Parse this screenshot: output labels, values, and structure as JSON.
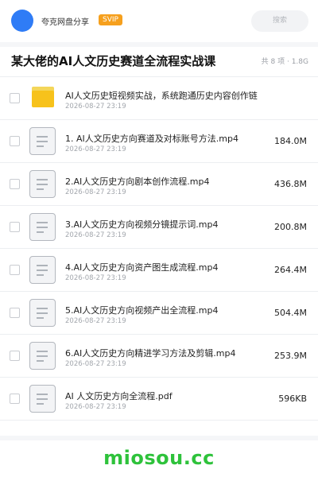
{
  "header": {
    "share_name": "夸克网盘分享",
    "badge": "SVIP",
    "search_label": "搜索"
  },
  "page": {
    "title": "某大佬的AI人文历史赛道全流程实战课",
    "meta": "共 8 项 · 1.8G"
  },
  "files": [
    {
      "type": "folder",
      "name": "AI人文历史短视频实战，系统跑通历史内容创作链",
      "date": "2026-08-27 23:19",
      "size": ""
    },
    {
      "type": "file",
      "name": "1. AI人文历史方向赛道及对标账号方法.mp4",
      "date": "2026-08-27 23:19",
      "size": "184.0M"
    },
    {
      "type": "file",
      "name": "2.AI人文历史方向剧本创作流程.mp4",
      "date": "2026-08-27 23:19",
      "size": "436.8M"
    },
    {
      "type": "file",
      "name": "3.AI人文历史方向视频分镜提示词.mp4",
      "date": "2026-08-27 23:19",
      "size": "200.8M"
    },
    {
      "type": "file",
      "name": "4.AI人文历史方向资产图生成流程.mp4",
      "date": "2026-08-27 23:19",
      "size": "264.4M"
    },
    {
      "type": "file",
      "name": "5.AI人文历史方向视频产出全流程.mp4",
      "date": "2026-08-27 23:19",
      "size": "504.4M"
    },
    {
      "type": "file",
      "name": "6.AI人文历史方向精进学习方法及剪辑.mp4",
      "date": "2026-08-27 23:19",
      "size": "253.9M"
    },
    {
      "type": "file",
      "name": "AI 人文历史方向全流程.pdf",
      "date": "2026-08-27 23:19",
      "size": "596KB"
    }
  ],
  "watermark": "miosou.cc",
  "colors": {
    "accent": "#2f7cf6",
    "badge": "#f6a01d",
    "folder": "#f7c21b",
    "watermark": "#2ec23b"
  }
}
